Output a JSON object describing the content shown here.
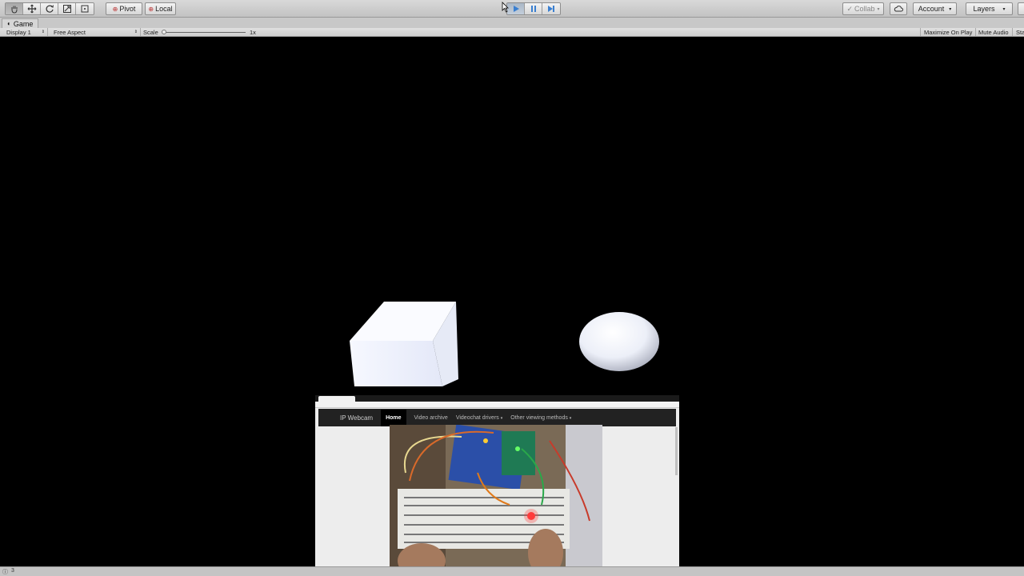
{
  "toolbar": {
    "pivot_label": "Pivot",
    "local_label": "Local",
    "collab_label": "Collab",
    "account_label": "Account",
    "layers_label": "Layers"
  },
  "game_tab": {
    "title": "Game"
  },
  "game_bar": {
    "display": "Display 1",
    "aspect": "Free Aspect",
    "scale_label": "Scale",
    "scale_value": "1x",
    "maximize_on_play": "Maximize On Play",
    "mute_audio": "Mute Audio",
    "stats": "Sta"
  },
  "webcam": {
    "brand": "IP Webcam",
    "nav_home": "Home",
    "nav_video_archive": "Video archive",
    "nav_videochat_drivers": "Videochat drivers",
    "nav_other_viewing": "Other viewing methods"
  },
  "status": {
    "count": "3"
  },
  "colors": {
    "toolbar_bg": "#c8c8c8",
    "scene_bg": "#000000",
    "play_active": "#4a8fd6"
  }
}
